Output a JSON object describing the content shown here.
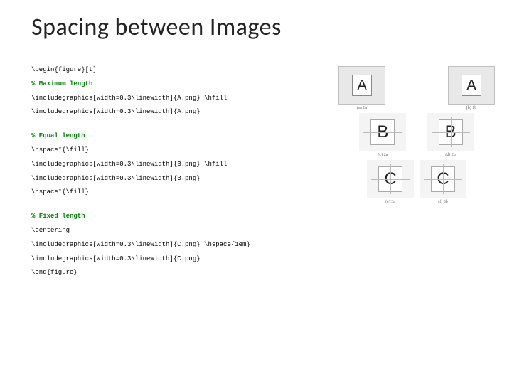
{
  "title": "Spacing between Images",
  "code": {
    "l1": "\\begin{figure}[t]",
    "c1": "% Maximum length",
    "l2": "\\includegraphics[width=0.3\\linewidth]{A.png} \\hfill",
    "l3": "\\includegraphics[width=0.3\\linewidth]{A.png}",
    "c2": "% Equal length",
    "l4": "\\hspace*{\\fill}",
    "l5": "\\includegraphics[width=0.3\\linewidth]{B.png} \\hfill",
    "l6": "\\includegraphics[width=0.3\\linewidth]{B.png}",
    "l7": "\\hspace*{\\fill}",
    "c3": "% Fixed length",
    "l8": "\\centering",
    "l9": "\\includegraphics[width=0.3\\linewidth]{C.png} \\hspace{1em}",
    "l10": "\\includegraphics[width=0.3\\linewidth]{C.png}",
    "l11": "\\end{figure}"
  },
  "letters": {
    "a": "A",
    "b": "B",
    "c": "C"
  },
  "captions": {
    "a1": "(a) 1a",
    "a2": "(b) 1b",
    "b1": "(c) 2a",
    "b2": "(d) 2b",
    "c1": "(e) 3a",
    "c2": "(f) 3b"
  }
}
